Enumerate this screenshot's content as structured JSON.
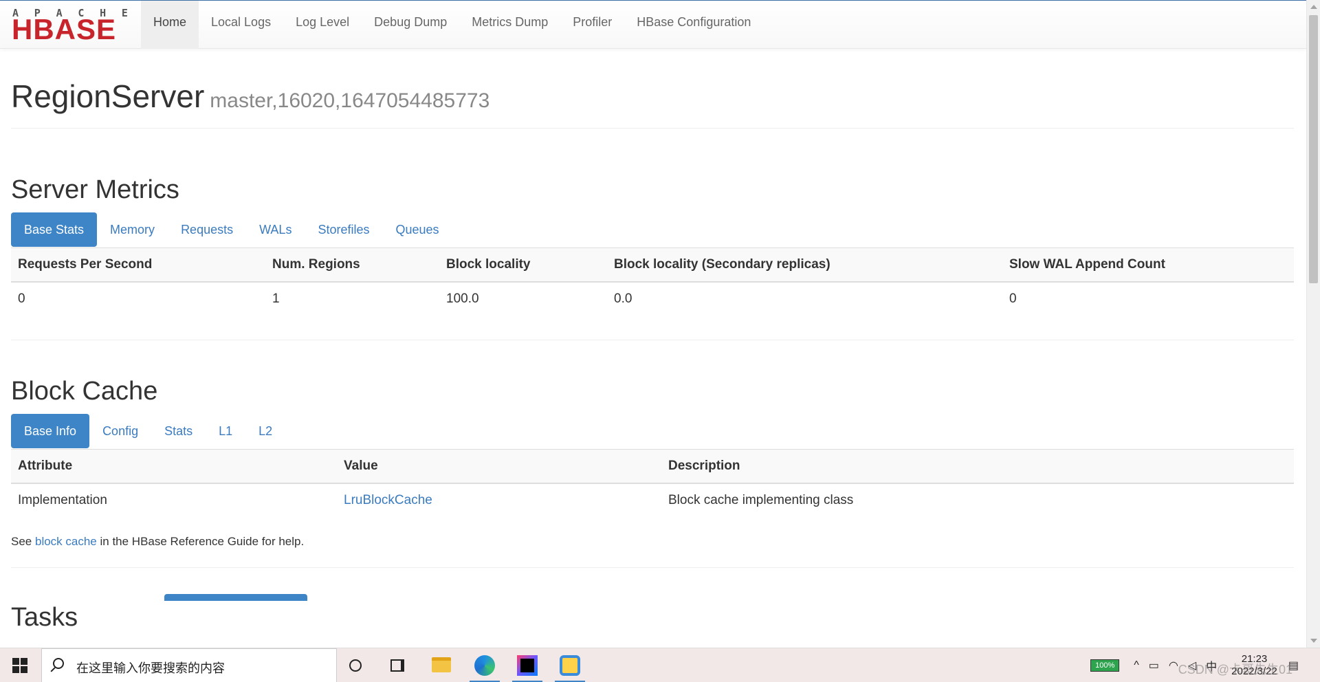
{
  "navbar": {
    "logo_top": "APACHE",
    "logo_main": "HBASE",
    "items": [
      {
        "label": "Home",
        "active": true
      },
      {
        "label": "Local Logs"
      },
      {
        "label": "Log Level"
      },
      {
        "label": "Debug Dump"
      },
      {
        "label": "Metrics Dump"
      },
      {
        "label": "Profiler"
      },
      {
        "label": "HBase Configuration"
      }
    ]
  },
  "header": {
    "title": "RegionServer",
    "subtitle": "master,16020,1647054485773"
  },
  "server_metrics": {
    "heading": "Server Metrics",
    "tabs": [
      "Base Stats",
      "Memory",
      "Requests",
      "WALs",
      "Storefiles",
      "Queues"
    ],
    "columns": [
      "Requests Per Second",
      "Num. Regions",
      "Block locality",
      "Block locality (Secondary replicas)",
      "Slow WAL Append Count"
    ],
    "row": [
      "0",
      "1",
      "100.0",
      "0.0",
      "0"
    ]
  },
  "block_cache": {
    "heading": "Block Cache",
    "tabs": [
      "Base Info",
      "Config",
      "Stats",
      "L1",
      "L2"
    ],
    "columns": [
      "Attribute",
      "Value",
      "Description"
    ],
    "row": {
      "attribute": "Implementation",
      "value": "LruBlockCache",
      "description": "Block cache implementing class"
    },
    "help_prefix": "See ",
    "help_link": "block cache",
    "help_suffix": " in the HBase Reference Guide for help."
  },
  "tasks": {
    "heading": "Tasks"
  },
  "taskbar": {
    "search_placeholder": "在这里输入你要搜索的内容",
    "battery": "100%",
    "ime": "中",
    "time": "21:23",
    "date": "2022/3/22",
    "watermark": "CSDN @卡哥先生01"
  }
}
